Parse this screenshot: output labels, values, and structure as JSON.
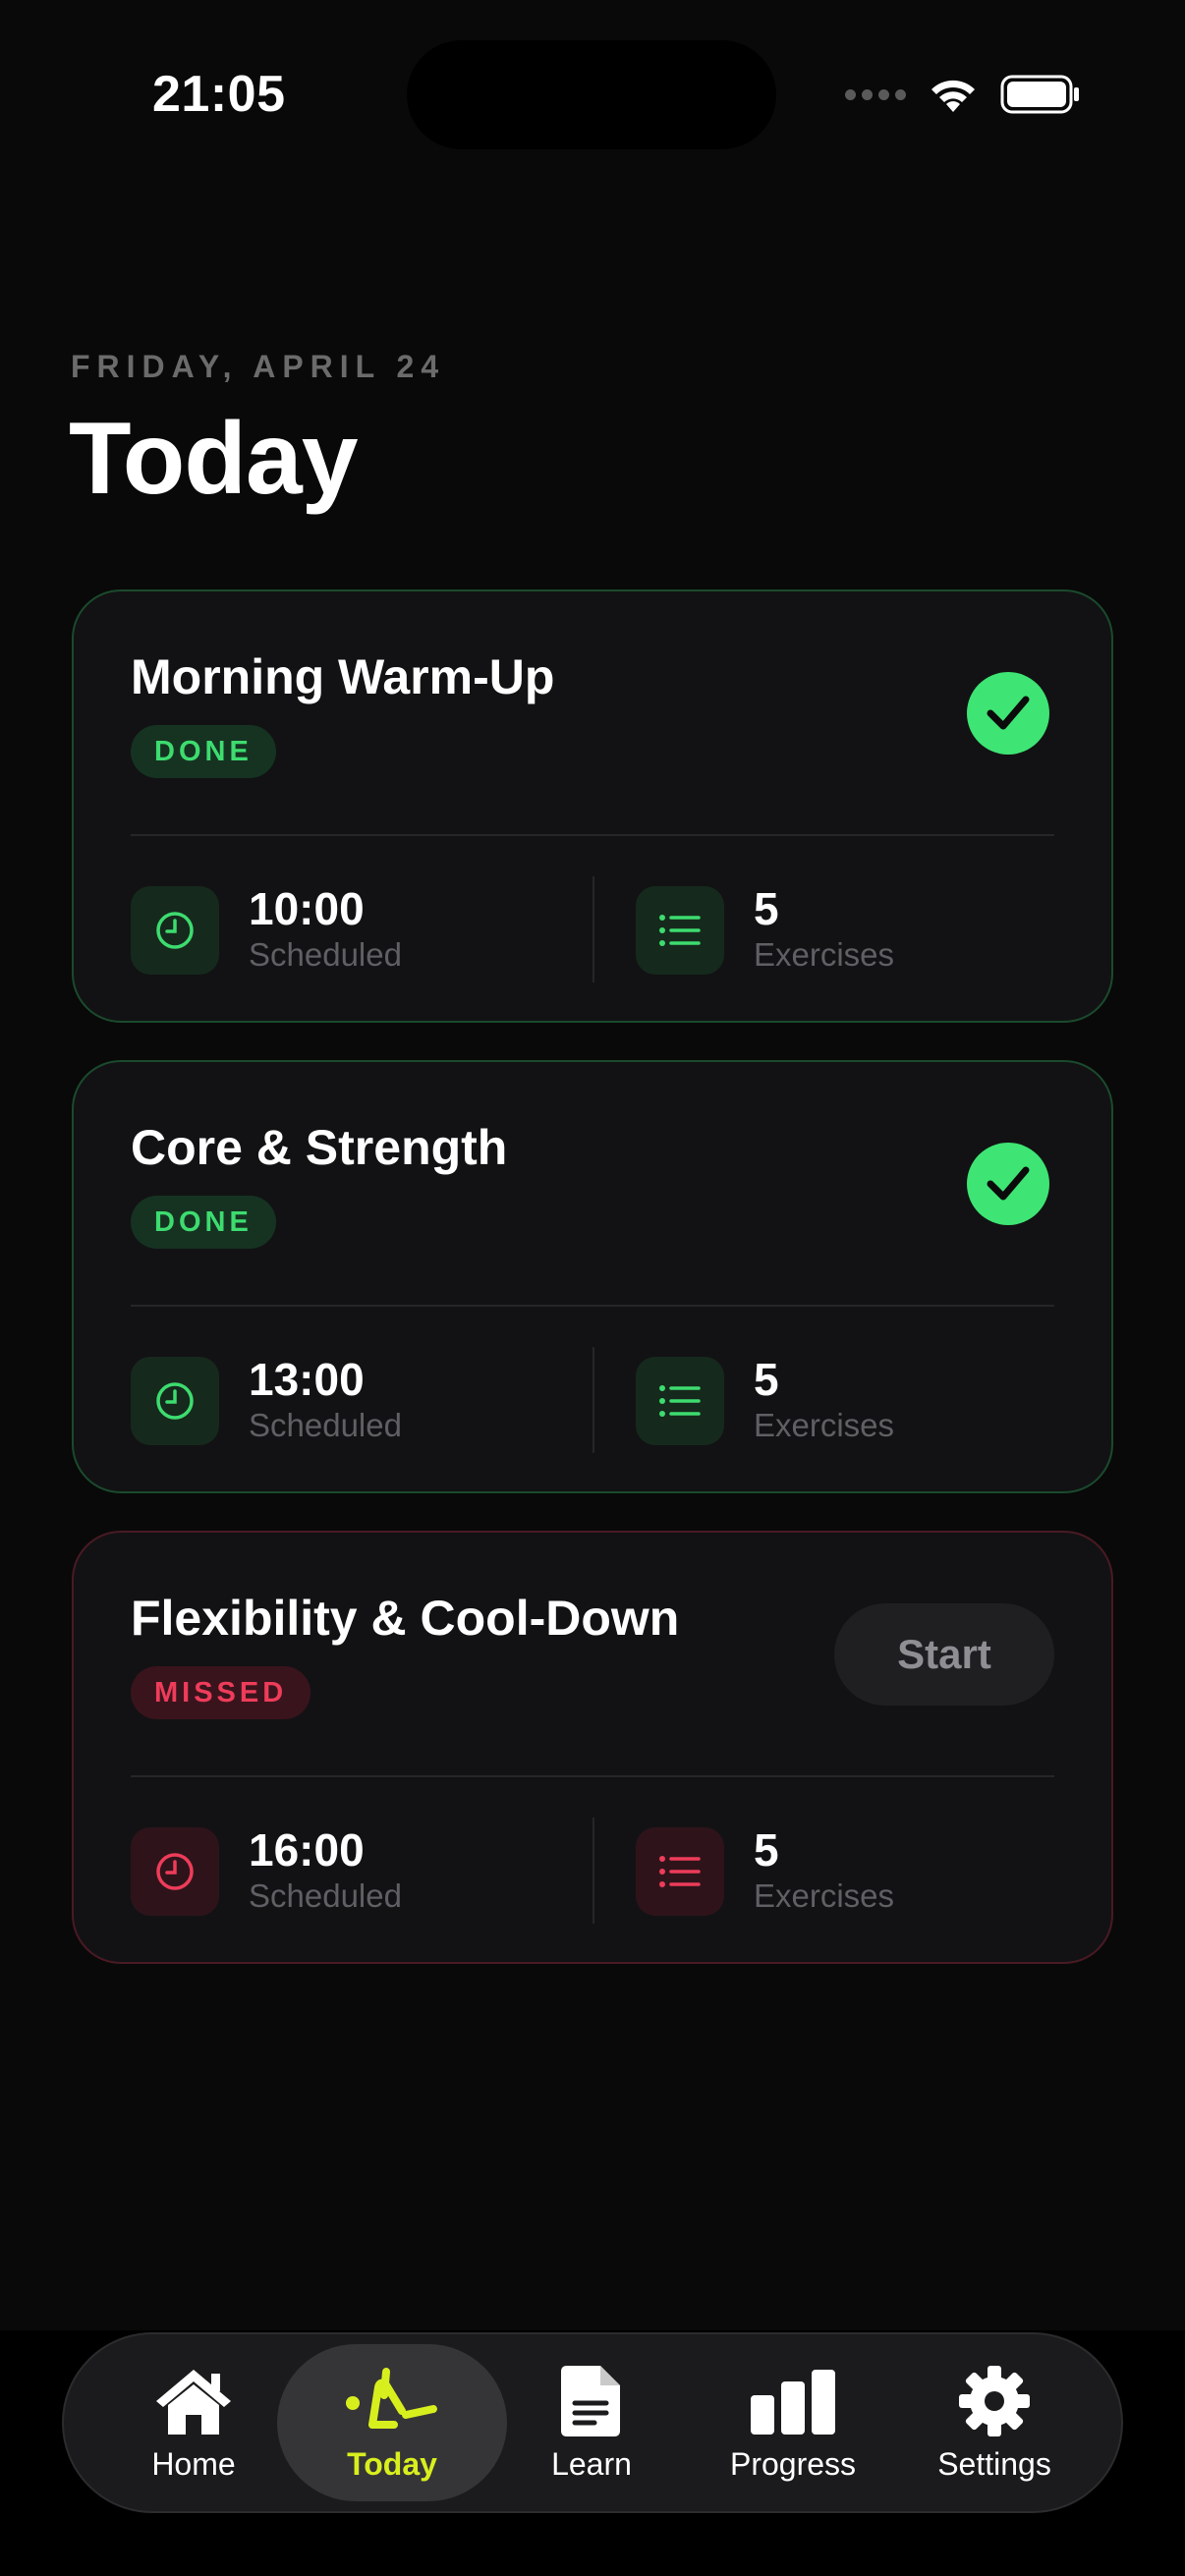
{
  "status_bar": {
    "time": "21:05"
  },
  "header": {
    "date": "FRIDAY, APRIL 24",
    "title": "Today"
  },
  "sessions": [
    {
      "title": "Morning Warm-Up",
      "status": "DONE",
      "time": "10:00",
      "time_label": "Scheduled",
      "exercises": "5",
      "exercises_label": "Exercises"
    },
    {
      "title": "Core & Strength",
      "status": "DONE",
      "time": "13:00",
      "time_label": "Scheduled",
      "exercises": "5",
      "exercises_label": "Exercises"
    },
    {
      "title": "Flexibility & Cool-Down",
      "status": "MISSED",
      "action_label": "Start",
      "time": "16:00",
      "time_label": "Scheduled",
      "exercises": "5",
      "exercises_label": "Exercises"
    }
  ],
  "tab_bar": {
    "items": [
      {
        "label": "Home",
        "icon": "home-icon"
      },
      {
        "label": "Today",
        "icon": "exercise-icon",
        "active": true
      },
      {
        "label": "Learn",
        "icon": "document-icon"
      },
      {
        "label": "Progress",
        "icon": "bar-chart-icon"
      },
      {
        "label": "Settings",
        "icon": "gear-icon"
      }
    ]
  },
  "colors": {
    "background": "#090909",
    "card": "#121214",
    "done_green": "#3ee574",
    "missed_red": "#ee3c5a",
    "active_tab": "#d8ef1e"
  }
}
